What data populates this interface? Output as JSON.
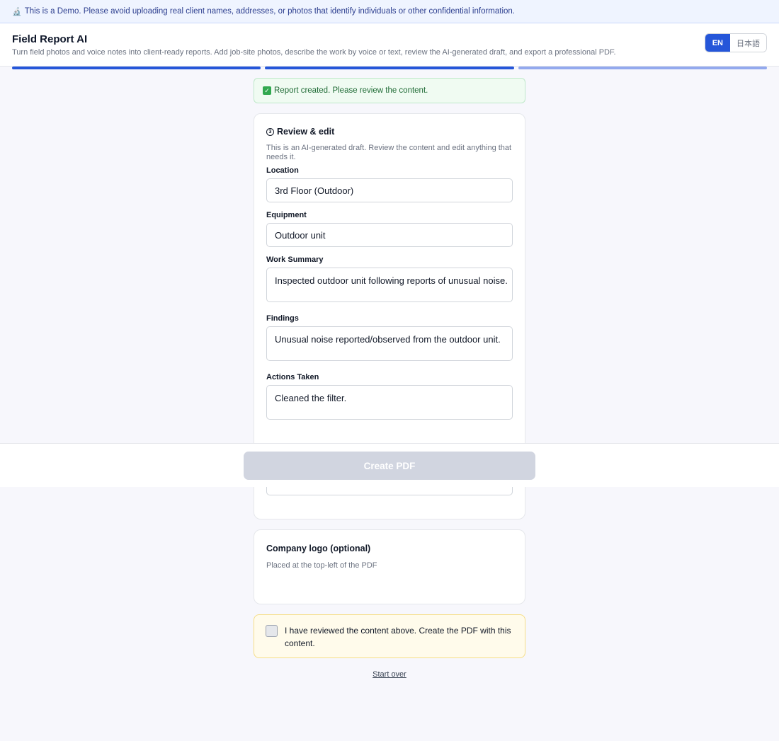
{
  "banner": {
    "icon": "microscope-icon",
    "text": "This is a Demo. Please avoid uploading real client names, addresses, or photos that identify individuals or other confidential information."
  },
  "header": {
    "title": "Field Report AI",
    "subtitle": "Turn field photos and voice notes into client-ready reports. Add job-site photos, describe the work by voice or text, review the AI-generated draft, and export a professional PDF.",
    "languages": [
      "EN",
      "日本語"
    ],
    "active_language": "EN"
  },
  "progress": {
    "steps_total": 3,
    "steps_complete": 2
  },
  "success": {
    "icon": "check-icon",
    "text": "Report created. Please review the content."
  },
  "review": {
    "step_number": "3",
    "title": "Review & edit",
    "description": "This is an AI-generated draft. Review the content and edit anything that needs it.",
    "fields": {
      "location": {
        "label": "Location",
        "value": "3rd Floor (Outdoor)"
      },
      "equipment": {
        "label": "Equipment",
        "value": "Outdoor unit"
      },
      "work_summary": {
        "label": "Work Summary",
        "value": "Inspected outdoor unit following reports of unusual noise."
      },
      "findings": {
        "label": "Findings",
        "value": "Unusual noise reported/observed from the outdoor unit."
      },
      "actions_taken": {
        "label": "Actions Taken",
        "value": "Cleaned the filter."
      }
    }
  },
  "logo": {
    "title": "Company logo (optional)",
    "description": "Placed at the top-left of the PDF"
  },
  "confirm": {
    "text": "I have reviewed the content above. Create the PDF with this content.",
    "checked": false
  },
  "actions": {
    "create_pdf": "Create PDF",
    "start_over": "Start over"
  },
  "colors": {
    "primary": "#2556d9",
    "success_bg": "#f0fbf2",
    "warning_bg": "#fffbeb",
    "disabled_button": "#d1d5e0"
  }
}
